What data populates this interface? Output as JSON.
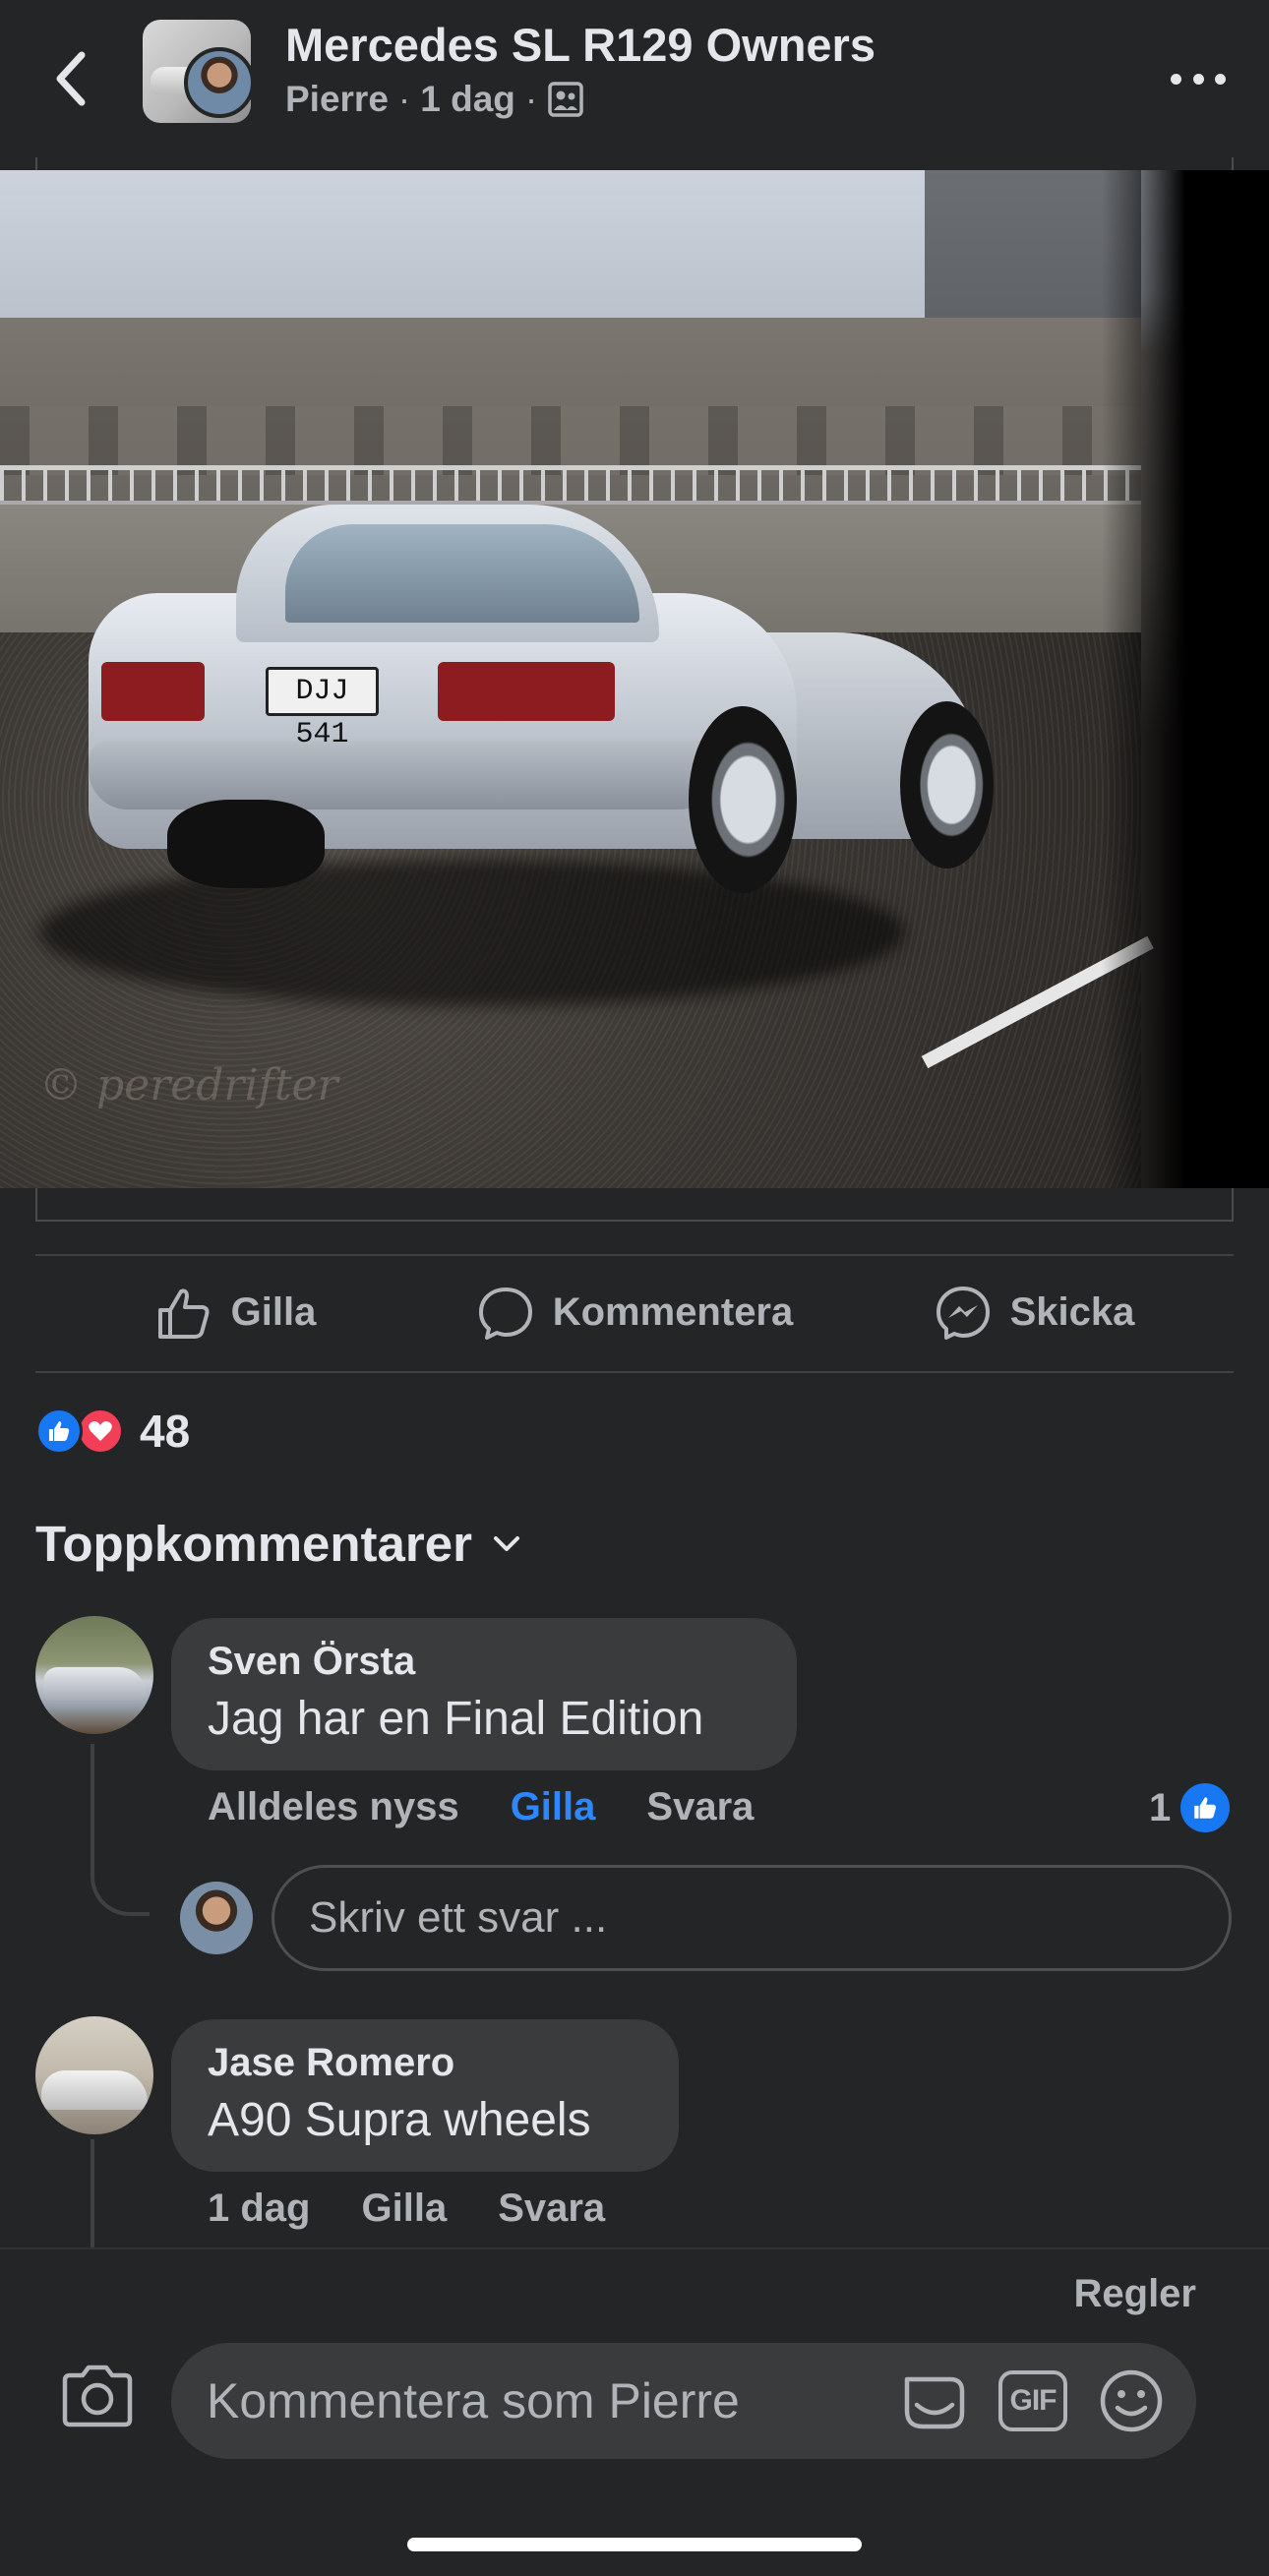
{
  "header": {
    "back_icon": "chevron-left-icon",
    "group_name": "Mercedes SL R129 Owners",
    "author": "Pierre",
    "separator": "·",
    "time": "1 dag",
    "privacy_icon": "group-members-icon",
    "more_icon": "ellipsis-icon"
  },
  "post": {
    "photo": {
      "plate_text": "DJJ 541",
      "watermark": "© peredrifter"
    }
  },
  "actions": {
    "like_label": "Gilla",
    "comment_label": "Kommentera",
    "share_label": "Skicka"
  },
  "reactions": {
    "count": "48",
    "types": [
      "like",
      "love"
    ]
  },
  "comments_section": {
    "sort_label": "Toppkommentarer"
  },
  "comments": [
    {
      "author": "Sven Örsta",
      "text": "Jag har en Final Edition",
      "time": "Alldeles nyss",
      "like_label": "Gilla",
      "reply_label": "Svara",
      "likes": "1"
    },
    {
      "author": "Jase Romero",
      "text": "A90 Supra wheels",
      "time": "1 dag",
      "like_label": "Gilla",
      "reply_label": "Svara"
    }
  ],
  "reply_box": {
    "placeholder": "Skriv ett svar ..."
  },
  "composer": {
    "rules_label": "Regler",
    "placeholder": "Kommentera som Pierre",
    "gif_label": "GIF"
  },
  "colors": {
    "background": "#242526",
    "bubble": "#3a3b3c",
    "accent": "#2d88ff",
    "muted_text": "#b0b3b8",
    "text": "#e4e6eb",
    "love": "#f33e58"
  }
}
